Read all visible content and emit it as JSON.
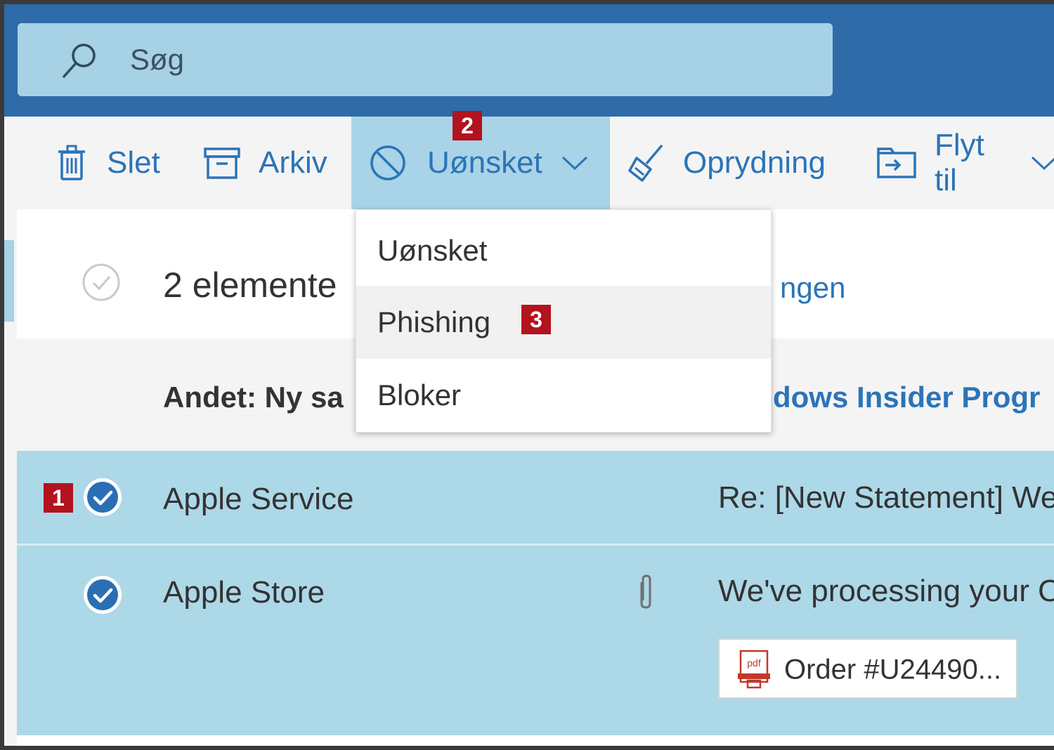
{
  "search": {
    "placeholder": "Søg",
    "icon": "search-icon"
  },
  "toolbar": {
    "delete_label": "Slet",
    "archive_label": "Arkiv",
    "junk_label": "Uønsket",
    "cleanup_label": "Oprydning",
    "move_label": "Flyt til"
  },
  "junk_menu": {
    "items": [
      {
        "label": "Uønsket"
      },
      {
        "label": "Phishing"
      },
      {
        "label": "Bloker"
      }
    ]
  },
  "selection": {
    "count_text": "2 elemente",
    "link_text": "ngen"
  },
  "other_banner": {
    "label": "Andet: Ny sa",
    "sender_fragment": "dows Insider Progr"
  },
  "messages": [
    {
      "sender": "Apple Service",
      "subject": "Re: [New Statement] We",
      "selected": true
    },
    {
      "sender": "Apple Store",
      "subject": "We've processing your O",
      "selected": true,
      "has_attachment": true,
      "attachment": {
        "name": "Order #U24490...",
        "type": "pdf"
      }
    }
  ],
  "annotations": {
    "badge1": "1",
    "badge2": "2",
    "badge3": "3"
  },
  "colors": {
    "topbar": "#2e6ba8",
    "search_bg": "#a7d1e5",
    "accent_text": "#2b74b8",
    "selected_row": "#add8e8",
    "badge": "#b3121f"
  }
}
